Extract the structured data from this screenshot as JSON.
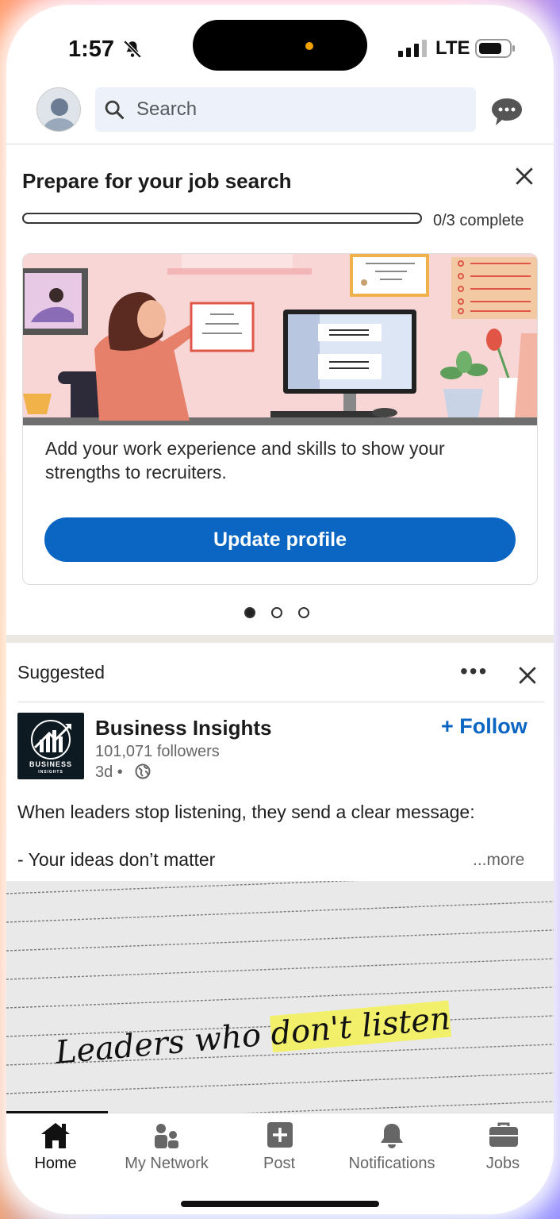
{
  "status_bar": {
    "time": "1:57",
    "network": "LTE"
  },
  "header": {
    "search_placeholder": "Search"
  },
  "job_card": {
    "title": "Prepare for your job search",
    "progress_fraction": 0,
    "progress_text": "0/3 complete",
    "description": "Add your work experience and skills to show your strengths to recruiters.",
    "button_label": "Update profile",
    "page_count": 3,
    "active_page": 0
  },
  "post": {
    "section_label": "Suggested",
    "author": "Business Insights",
    "logo_text_top": "BUSINESS",
    "logo_text_bottom": "INSIGHTS",
    "followers": "101,071 followers",
    "time": "3d •",
    "follow_label": "+ Follow",
    "body_line1": "When leaders stop listening, they send a clear message:",
    "body_line2": "- Your ideas don’t matter",
    "see_more": "...more",
    "image_text_a": "Leaders who ",
    "image_text_b": "don't listen"
  },
  "nav": {
    "items": [
      {
        "label": "Home",
        "icon": "home-icon"
      },
      {
        "label": "My Network",
        "icon": "network-icon"
      },
      {
        "label": "Post",
        "icon": "post-icon"
      },
      {
        "label": "Notifications",
        "icon": "bell-icon"
      },
      {
        "label": "Jobs",
        "icon": "briefcase-icon"
      }
    ]
  },
  "colors": {
    "accent": "#0a66c2",
    "notch_dot": "#f4a100"
  }
}
